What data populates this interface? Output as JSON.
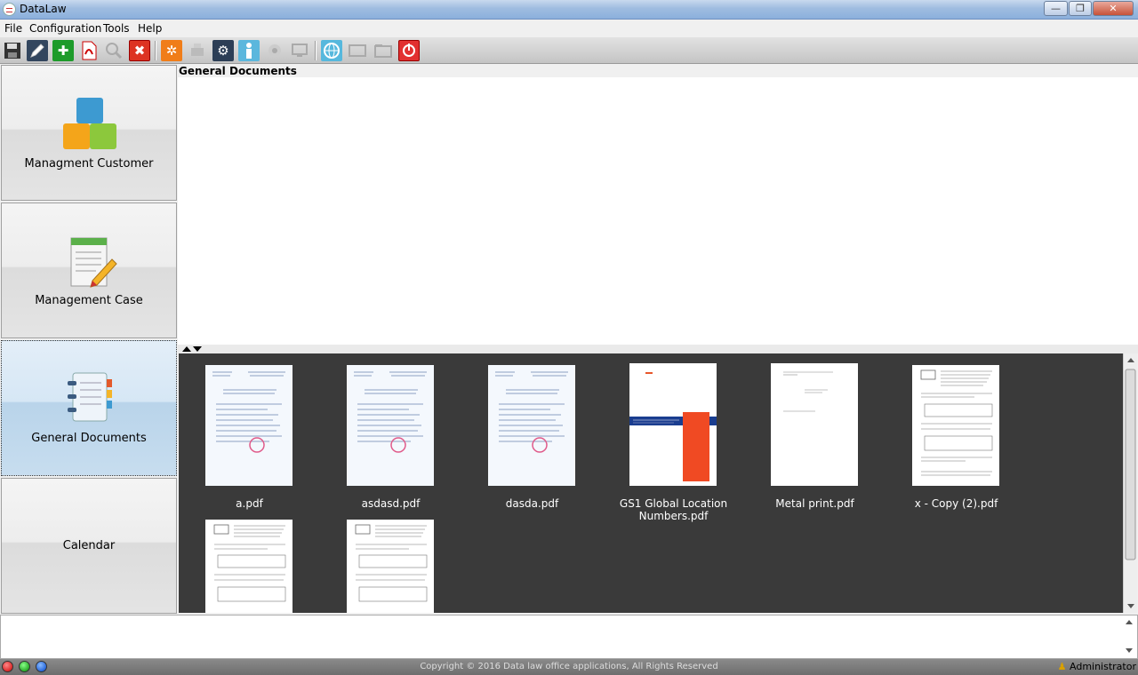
{
  "window": {
    "title": "DataLaw",
    "minimize": "—",
    "maximize": "❐",
    "close": "✕"
  },
  "menu": [
    "File",
    "Configuration",
    "Tools",
    "Help"
  ],
  "toolbar": {
    "icons": [
      "save-icon",
      "edit-icon",
      "add-icon",
      "pdf-icon",
      "search-icon",
      "delete-icon",
      "settings-icon",
      "print-icon",
      "config-icon",
      "user-icon",
      "scan-icon",
      "monitor-icon",
      "globe-icon",
      "message-icon",
      "folder-icon",
      "power-icon"
    ]
  },
  "sidebar": {
    "items": [
      {
        "label": "Managment Customer"
      },
      {
        "label": "Management Case"
      },
      {
        "label": "General Documents"
      },
      {
        "label": "Calendar"
      }
    ]
  },
  "panel": {
    "title": "General Documents"
  },
  "documents": [
    {
      "name": "a.pdf"
    },
    {
      "name": "asdasd.pdf"
    },
    {
      "name": "dasda.pdf"
    },
    {
      "name": "GS1 Global Location Numbers.pdf"
    },
    {
      "name": "Metal print.pdf"
    },
    {
      "name": "x - Copy (2).pdf"
    },
    {
      "name": ""
    },
    {
      "name": ""
    }
  ],
  "footer": {
    "copyright": "Copyright © 2016 Data law office applications, All Rights Reserved",
    "user": "Administrator"
  }
}
